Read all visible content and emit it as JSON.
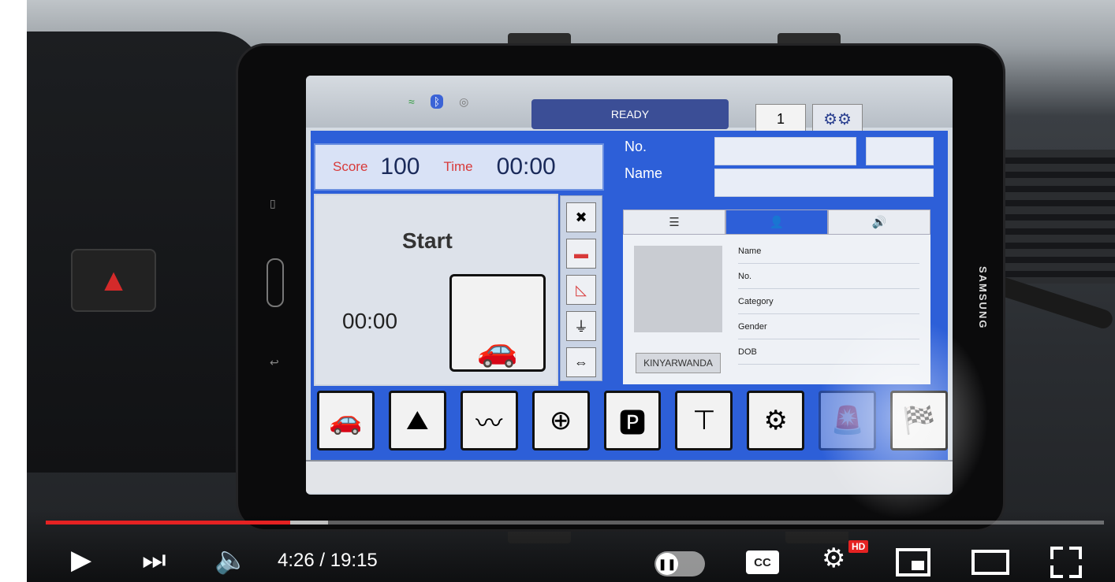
{
  "tablet": {
    "brand": "SAMSUNG",
    "app": {
      "status": "READY",
      "counter": "1",
      "score_label": "Score",
      "score_value": "100",
      "time_label": "Time",
      "time_value": "00:00",
      "main_label": "Start",
      "main_timer": "00:00",
      "no_label": "No.",
      "name_label": "Name",
      "tabs": [
        "☰",
        "👤",
        "🔊"
      ],
      "language_button": "KINYARWANDA",
      "profile_fields": [
        "Name",
        "No.",
        "Category",
        "Gender",
        "DOB"
      ],
      "side_tools": [
        "seatbelt-tool-icon",
        "belt-icon",
        "brake-icon",
        "plug-icon",
        "signal-arrows-icon"
      ],
      "bottom_icons": [
        "start-hill-icon",
        "slope-icon",
        "s-curve-icon",
        "roundabout-icon",
        "parking-icon",
        "t-junction-icon",
        "gear-shift-icon",
        "emergency-icon",
        "finish-icon"
      ]
    }
  },
  "player": {
    "current_time": "4:26",
    "duration": "19:15",
    "time_display": "4:26 / 19:15",
    "progress_fraction": 0.231,
    "buffer_fraction": 0.267,
    "cc_label": "CC",
    "hd_badge": "HD",
    "colors": {
      "progress": "#e52222",
      "app_panel": "#2d5fd8",
      "ready_bar": "#3b4e96"
    }
  }
}
